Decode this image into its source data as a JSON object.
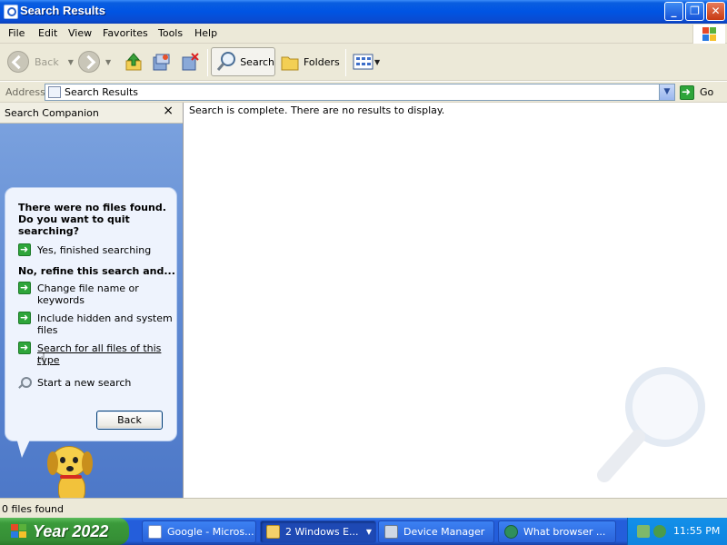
{
  "window": {
    "title": "Search Results"
  },
  "menu": [
    "File",
    "Edit",
    "View",
    "Favorites",
    "Tools",
    "Help"
  ],
  "toolbar": {
    "back_label": "Back",
    "search_label": "Search",
    "folders_label": "Folders"
  },
  "address": {
    "label": "Address",
    "value": "Search Results",
    "go_label": "Go"
  },
  "pane": {
    "title": "Search Companion",
    "close": "×",
    "heading": "There were no files found. Do you want to quit searching?",
    "yes_option": "Yes, finished searching",
    "refine_heading": "No, refine this search and...",
    "options": [
      "Change file name or keywords",
      "Include hidden and system files",
      "Search for all files of this type"
    ],
    "new_search": "Start a new search",
    "back_button": "Back"
  },
  "results": {
    "message": "Search is complete. There are no results to display."
  },
  "status": {
    "text": "0 files found"
  },
  "taskbar": {
    "start_label": "Year 2022",
    "buttons": [
      {
        "label": "Google - Micros...",
        "icon_color": "#ffffff"
      },
      {
        "label": "2  Windows E...",
        "icon_color": "#f4d06a"
      },
      {
        "label": "Device Manager",
        "icon_color": "#cfd8e4"
      },
      {
        "label": "What browser ...",
        "icon_color": "#2f8f5b"
      }
    ],
    "clock": "11:55 PM"
  },
  "colors": {
    "title_blue": "#0054e3",
    "pane_blue": "#6f96d8",
    "start_green": "#3a9a3a",
    "tray_blue": "#1290e9"
  }
}
